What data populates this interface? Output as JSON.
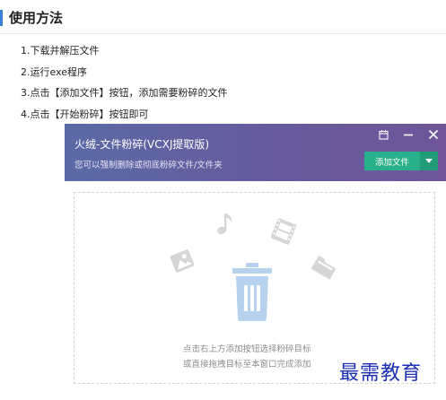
{
  "section": {
    "title": "使用方法"
  },
  "steps": [
    "1.下载并解压文件",
    "2.运行exe程序",
    "3.点击【添加文件】按钮，添加需要粉碎的文件",
    "4.点击【开始粉碎】按钮即可"
  ],
  "app": {
    "title": "火绒-文件粉碎(VCXJ提取版)",
    "subtitle": "您可以强制删除或彻底粉碎文件/文件夹",
    "add_button_label": "添加文件",
    "hint_line1": "点击右上方添加按钮选择粉碎目标",
    "hint_line2": "或直接拖拽目标至本窗口完成添加",
    "colors": {
      "header_start": "#5b6aa7",
      "header_end": "#6f5699",
      "add_button": "#27b089",
      "trash": "#b7d2ee",
      "faded_icon": "#d6d6d6"
    }
  },
  "watermark": "最需教育",
  "icons": [
    "pin-icon",
    "minimize-icon",
    "close-icon",
    "dropdown-arrow-icon",
    "image-file-icon",
    "music-note-icon",
    "film-file-icon",
    "folder-icon",
    "trash-icon"
  ]
}
